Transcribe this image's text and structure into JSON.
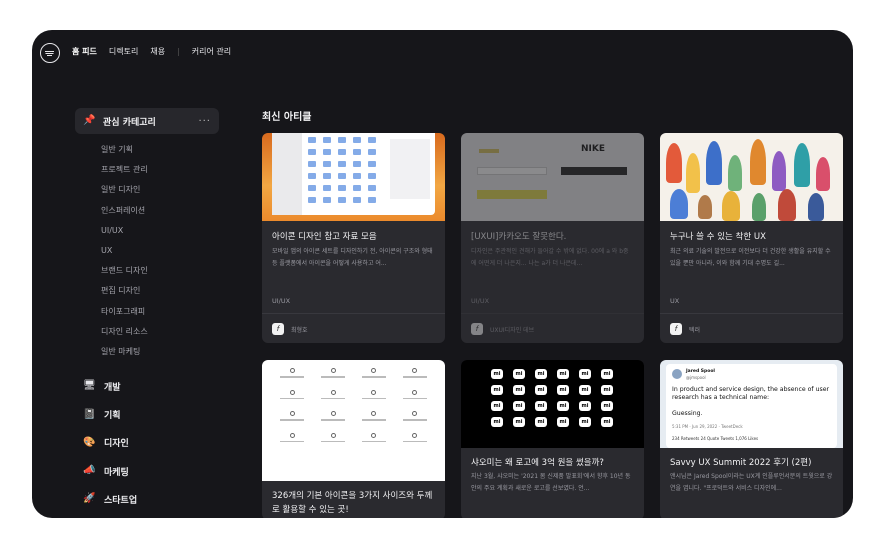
{
  "nav": {
    "items": [
      {
        "label": "홈 피드",
        "active": true
      },
      {
        "label": "디렉토리",
        "active": false
      },
      {
        "label": "채용",
        "active": false
      }
    ],
    "separator": "|",
    "career_label": "커리어 관리"
  },
  "sidebar": {
    "category_header": "관심 카테고리",
    "category_more": "···",
    "sub_items": [
      "일반 기획",
      "프로젝트 관리",
      "일반 디자인",
      "인스퍼레이션",
      "UI/UX",
      "UX",
      "브랜드 디자인",
      "편집 디자인",
      "타이포그래피",
      "디자인 리소스",
      "일반 마케팅"
    ],
    "groups": [
      {
        "label": "개발",
        "icon": "monitor-icon"
      },
      {
        "label": "기획",
        "icon": "notepad-icon"
      },
      {
        "label": "디자인",
        "icon": "palette-icon"
      },
      {
        "label": "마케팅",
        "icon": "megaphone-icon"
      },
      {
        "label": "스타트업",
        "icon": "rocket-icon"
      }
    ]
  },
  "main": {
    "section_title": "최신 아티클",
    "cards": [
      {
        "title": "아이콘 디자인 참고 자료 모음",
        "desc": "모바일 앱의 아이콘 세트를 디자인하기 전, 아이콘의 구조와 형태 등 플랫폼에서 아이콘을 어떻게 사용하고 어...",
        "tag": "UI/UX",
        "author": "최형호",
        "faded": false
      },
      {
        "title": "[UXUI]카카오도 잘못한다.",
        "desc": "디자인은 주관적인 견해가 들어갈 수 밖에 없다. 00에 a 와 b중에 어떤게 더 나은지... 나는 a가 더 나은데...",
        "tag": "UI/UX",
        "author": "UXUI디자인 데브",
        "faded": true
      },
      {
        "title": "누구나 쓸 수 있는 착한 UX",
        "desc": "최근 의료 기술의 발전으로 이전보다 더 건강한 생활을 유지할 수 있을 뿐만 아니라, 이와 함께 기대 수명도 길...",
        "tag": "UX",
        "author": "텍러",
        "faded": false
      },
      {
        "title": "326개의 기본 아이콘을 3가지 사이즈와 두께로 활용할 수 있는 곳!",
        "desc": "",
        "tag": "",
        "author": "",
        "faded": false
      },
      {
        "title": "샤오미는 왜 로고에 3억 원을 썼을까?",
        "desc": "지난 3월, 샤오미는 '2021 봄 신제품 발표회'에서 향후 10년 동안의 주요 계획과 새로운 로고를 선보였다. 언...",
        "tag": "",
        "author": "",
        "faded": false
      },
      {
        "title": "Savvy UX Summit 2022 후기 (2편)",
        "desc": "앤시님은 Jared Spool이라는 UX계 인플루언서분의 트윗으로 강연을 엽니다. \"프로덕트와 서비스 디자인에...",
        "tag": "",
        "author": "",
        "faded": false
      }
    ],
    "tweet": {
      "name": "Jared Spool",
      "handle": "@jmspool",
      "text": "In product and service design, the absence of user research has a technical name:",
      "text2": "Guessing.",
      "meta": "5:31 PM · Jun 29, 2022 · TweetDeck",
      "stats": "234 Retweets   24 Quote Tweets   1,076 Likes"
    },
    "kakao_brand": "NIKE",
    "mi_label": "mi"
  },
  "colors": {
    "background": "#16161a",
    "card": "#2a2a2f",
    "accent_text": "#f2f2f4",
    "muted_text": "#9a9aa2"
  }
}
